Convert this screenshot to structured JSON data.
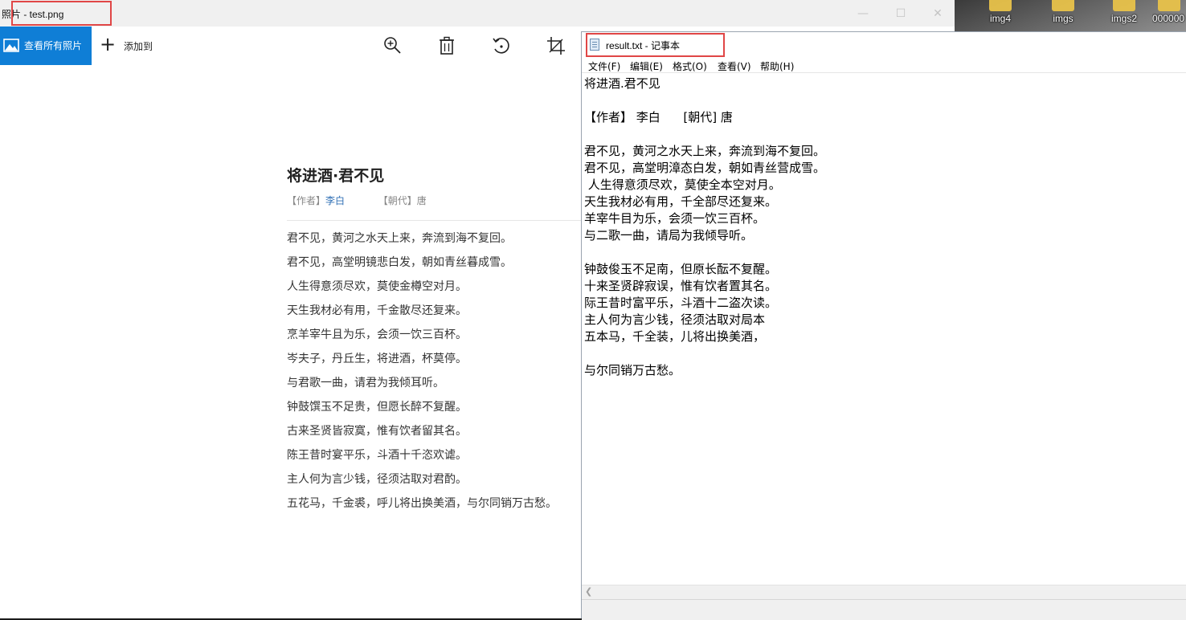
{
  "desktop": {
    "icons": [
      {
        "label": "img4"
      },
      {
        "label": "imgs"
      },
      {
        "label": "imgs2"
      },
      {
        "label": "000000"
      }
    ]
  },
  "photos": {
    "title": "照片 - test.png",
    "toolbar": {
      "view_all_label": "查看所有照片",
      "add_label": "添加到",
      "tools": [
        "zoom-icon",
        "delete-icon",
        "rotate-icon",
        "crop-icon"
      ]
    },
    "poem": {
      "title": "将进酒·君不见",
      "author_label": "【作者】",
      "author": "李白",
      "dynasty_label": "【朝代】",
      "dynasty": "唐",
      "lines": [
        "君不见，黄河之水天上来，奔流到海不复回。",
        "君不见，高堂明镜悲白发，朝如青丝暮成雪。",
        "人生得意须尽欢，莫使金樽空对月。",
        "天生我材必有用，千金散尽还复来。",
        "烹羊宰牛且为乐，会须一饮三百杯。",
        "岑夫子，丹丘生，将进酒，杯莫停。",
        "与君歌一曲，请君为我倾耳听。",
        "钟鼓馔玉不足贵，但愿长醉不复醒。",
        "古来圣贤皆寂寞，惟有饮者留其名。",
        "陈王昔时宴平乐，斗酒十千恣欢谑。",
        "主人何为言少钱，径须沽取对君酌。",
        "五花马，千金裘，呼儿将出换美酒，与尔同销万古愁。"
      ]
    }
  },
  "notepad": {
    "title": "result.txt - 记事本",
    "menus": [
      "文件(F)",
      "编辑(E)",
      "格式(O)",
      "查看(V)",
      "帮助(H)"
    ],
    "lines": [
      "将进酒.君不见",
      "",
      "【作者】 李白      [朝代] 唐",
      "",
      "君不见，黄河之水天上来，奔流到海不复回。",
      "君不见，高堂明漳态白发，朝如青丝营成雪。",
      " 人生得意须尽欢，莫使全本空对月。",
      "天生我材必有用，千全部尽还复来。",
      "羊宰牛目为乐，会须一饮三百杯。",
      "与二歌一曲，请局为我倾导听。",
      "",
      "钟鼓俊玉不足南，但原长酝不复醒。",
      "十来圣贤辟寂误，惟有饮者置其名。",
      "际王昔时富平乐，斗酒十二盗次读。",
      "主人何为言少钱，径须沽取对局本",
      "五本马，千全装，儿将出换美酒，",
      "",
      "与尔同销万古愁。"
    ]
  },
  "colors": {
    "accent_blue": "#0f7ed6",
    "highlight_red": "#e04646",
    "author_link": "#2f6fb5"
  }
}
